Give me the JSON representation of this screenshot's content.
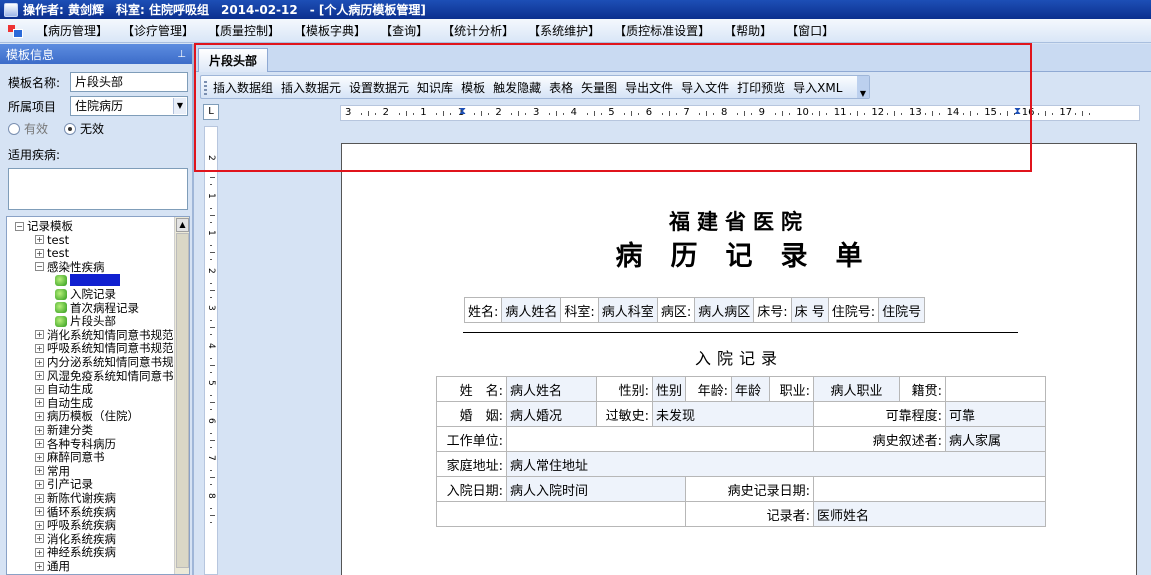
{
  "title": {
    "operator": "操作者: 黄剑辉",
    "dept": "科室: 住院呼吸组",
    "date": "2014-02-12",
    "window": "- [个人病历模板管理]"
  },
  "menu": [
    "【病历管理】",
    "【诊疗管理】",
    "【质量控制】",
    "【模板字典】",
    "【查询】",
    "【统计分析】",
    "【系统维护】",
    "【质控标准设置】",
    "【帮助】",
    "【窗口】"
  ],
  "left": {
    "header": "模板信息",
    "name_label": "模板名称:",
    "name_value": "片段头部",
    "project_label": "所属项目",
    "project_value": "住院病历",
    "radio_valid": "有效",
    "radio_invalid": "无效",
    "disease_label": "适用疾病:",
    "tree": [
      {
        "label": "记录模板",
        "level": 0,
        "exp": "−"
      },
      {
        "label": "test",
        "level": 1,
        "exp": "+"
      },
      {
        "label": "test",
        "level": 1,
        "exp": "+"
      },
      {
        "label": "感染性疾病",
        "level": 1,
        "exp": "−"
      },
      {
        "label": "",
        "level": 2,
        "leaf": true,
        "selected": true
      },
      {
        "label": "入院记录",
        "level": 2,
        "leaf": true
      },
      {
        "label": "首次病程记录",
        "level": 2,
        "leaf": true
      },
      {
        "label": "片段头部",
        "level": 2,
        "leaf": true
      },
      {
        "label": "消化系统知情同意书规范",
        "level": 1,
        "exp": "+"
      },
      {
        "label": "呼吸系统知情同意书规范",
        "level": 1,
        "exp": "+"
      },
      {
        "label": "内分泌系统知情同意书规",
        "level": 1,
        "exp": "+"
      },
      {
        "label": "风湿免疫系统知情同意书",
        "level": 1,
        "exp": "+"
      },
      {
        "label": "自动生成",
        "level": 1,
        "exp": "+"
      },
      {
        "label": "自动生成",
        "level": 1,
        "exp": "+"
      },
      {
        "label": "病历模板（住院）",
        "level": 1,
        "exp": "+"
      },
      {
        "label": "新建分类",
        "level": 1,
        "exp": "+"
      },
      {
        "label": "各种专科病历",
        "level": 1,
        "exp": "+"
      },
      {
        "label": "麻醉同意书",
        "level": 1,
        "exp": "+"
      },
      {
        "label": "常用",
        "level": 1,
        "exp": "+"
      },
      {
        "label": "引产记录",
        "level": 1,
        "exp": "+"
      },
      {
        "label": "新陈代谢疾病",
        "level": 1,
        "exp": "+"
      },
      {
        "label": "循环系统疾病",
        "level": 1,
        "exp": "+"
      },
      {
        "label": "呼吸系统疾病",
        "level": 1,
        "exp": "+"
      },
      {
        "label": "消化系统疾病",
        "level": 1,
        "exp": "+"
      },
      {
        "label": "神经系统疾病",
        "level": 1,
        "exp": "+"
      },
      {
        "label": "通用",
        "level": 1,
        "exp": "+"
      }
    ]
  },
  "tab": "片段头部",
  "toolbar": [
    "插入数据组",
    "插入数据元",
    "设置数据元",
    "知识库",
    "模板",
    "触发隐藏",
    "表格",
    "矢量图",
    "导出文件",
    "导入文件",
    "打印预览",
    "导入XML"
  ],
  "ruler": [
    "3",
    "2",
    "1",
    "1",
    "2",
    "3",
    "4",
    "5",
    "6",
    "7",
    "8",
    "9",
    "10",
    "11",
    "12",
    "13",
    "14",
    "15",
    "16",
    "17"
  ],
  "vruler": [
    "2",
    "1",
    "1",
    "2",
    "3",
    "4",
    "5",
    "6",
    "7",
    "8"
  ],
  "doc": {
    "hospital": "福建省医院",
    "title": "病历记录单",
    "header_row": [
      {
        "t": "姓名:",
        "f": false
      },
      {
        "t": "病人姓名",
        "f": true
      },
      {
        "t": "科室:",
        "f": false
      },
      {
        "t": "病人科室",
        "f": true
      },
      {
        "t": "病区:",
        "f": false
      },
      {
        "t": "病人病区",
        "f": true
      },
      {
        "t": "床号:",
        "f": false
      },
      {
        "t": "床 号",
        "f": true
      },
      {
        "t": "住院号:",
        "f": false
      },
      {
        "t": "住院号",
        "f": true
      }
    ],
    "section": "入院记录",
    "r1": [
      "姓　名:",
      "病人姓名",
      "性别:",
      "性别",
      "年龄:",
      "年龄",
      "职业:",
      "病人职业",
      "籍贯:",
      ""
    ],
    "r2": [
      "婚　姻:",
      "病人婚况",
      "过敏史:",
      "未发现",
      "可靠程度:",
      "可靠"
    ],
    "r3": [
      "工作单位:",
      "",
      "病史叙述者:",
      "病人家属"
    ],
    "r4": [
      "家庭地址:",
      "病人常住地址"
    ],
    "r5": [
      "入院日期:",
      "病人入院时间",
      "病史记录日期:",
      ""
    ],
    "r6": [
      "记录者:",
      "医师姓名"
    ]
  }
}
